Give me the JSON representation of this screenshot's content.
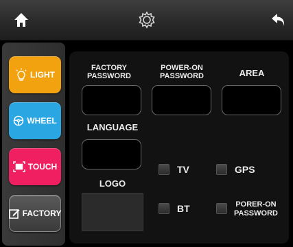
{
  "toolbar": {
    "home_icon": "home-icon",
    "settings_icon": "gear-icon",
    "back_icon": "back-arrow-icon"
  },
  "sidebar": {
    "items": [
      {
        "label": "LIGHT",
        "icon": "lightbulb-icon",
        "color": "#f2a20f"
      },
      {
        "label": "WHEEL",
        "icon": "steering-wheel-icon",
        "color": "#2aa6e3"
      },
      {
        "label": "TOUCH",
        "icon": "touch-screen-icon",
        "color": "#ef1f62"
      },
      {
        "label": "FACTORY",
        "icon": "edit-icon",
        "color": "#4a4a4a"
      }
    ]
  },
  "form": {
    "factory_password": {
      "label_line1": "FACTORY",
      "label_line2": "PASSWORD",
      "value": ""
    },
    "power_on_password": {
      "label_line1": "POWER-ON",
      "label_line2": "PASSWORD",
      "value": ""
    },
    "area": {
      "label": "AREA",
      "value": ""
    },
    "language": {
      "label": "LANGUAGE",
      "value": ""
    },
    "logo": {
      "label": "LOGO"
    }
  },
  "options": {
    "tv": {
      "label": "TV",
      "checked": false
    },
    "gps": {
      "label": "GPS",
      "checked": false
    },
    "bt": {
      "label": "BT",
      "checked": false
    },
    "poweron": {
      "label_line1": "PORER-ON",
      "label_line2": "PASSWORD",
      "checked": false
    }
  }
}
